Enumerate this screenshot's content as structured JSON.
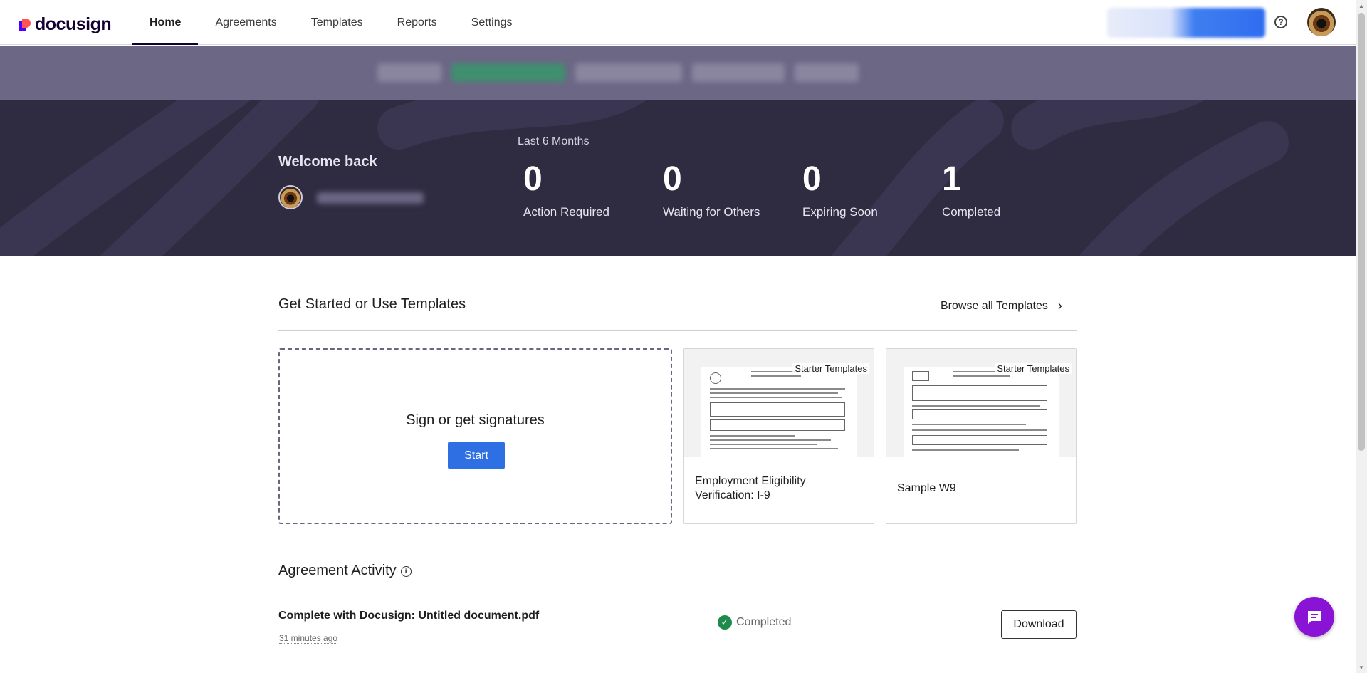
{
  "app": {
    "logo_text": "docusign",
    "brand_colors": {
      "purple": "#4c00ff",
      "coral": "#ff5252",
      "navy": "#130032"
    }
  },
  "nav": {
    "items": [
      {
        "label": "Home",
        "active": true
      },
      {
        "label": "Agreements",
        "active": false
      },
      {
        "label": "Templates",
        "active": false
      },
      {
        "label": "Reports",
        "active": false
      },
      {
        "label": "Settings",
        "active": false
      }
    ],
    "help_icon": "?",
    "icons": [
      "help-circle-icon",
      "avatar"
    ]
  },
  "hero": {
    "welcome": "Welcome back",
    "period": "Last 6 Months",
    "stats": [
      {
        "value": "0",
        "label": "Action Required"
      },
      {
        "value": "0",
        "label": "Waiting for Others"
      },
      {
        "value": "0",
        "label": "Expiring Soon"
      },
      {
        "value": "1",
        "label": "Completed"
      }
    ]
  },
  "templates": {
    "title": "Get Started or Use Templates",
    "browse_label": "Browse all Templates",
    "sign_title": "Sign or get signatures",
    "start_label": "Start",
    "cards": [
      {
        "badge": "Starter Templates",
        "name": "Employment Eligibility Verification: I-9"
      },
      {
        "badge": "Starter Templates",
        "name": "Sample W9"
      }
    ]
  },
  "activity": {
    "title": "Agreement Activity",
    "info_icon": "i",
    "rows": [
      {
        "title": "Complete with Docusign: Untitled document.pdf",
        "time": "31 minutes ago",
        "status": "Completed",
        "status_icon": "✓",
        "status_color": "#1e8a4c",
        "action": "Download"
      }
    ]
  },
  "scrollbar": {
    "up_icon": "▲",
    "down_icon": "▼"
  }
}
